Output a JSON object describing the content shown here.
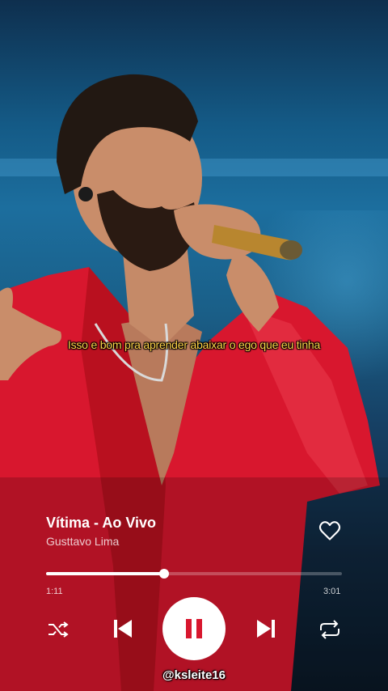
{
  "lyrics": {
    "current_line": "Isso e bom pra aprender abaixar o ego que eu tinha"
  },
  "track": {
    "title": "Vítima - Ao Vivo",
    "artist": "Gusttavo Lima",
    "liked": false,
    "progress_fraction": 0.4
  },
  "timeline": {
    "elapsed": "1:11",
    "total": "3:01"
  },
  "controls": {
    "shuffle": "shuffle-icon",
    "previous": "skip-back-icon",
    "play_pause": "pause-icon",
    "next": "skip-forward-icon",
    "repeat": "repeat-icon"
  },
  "watermark": {
    "text": "@ksleite16"
  },
  "colors": {
    "subtitle": "#ffd34a",
    "jacket": "#d8172e",
    "stage_blue": "#1c6e9e"
  }
}
